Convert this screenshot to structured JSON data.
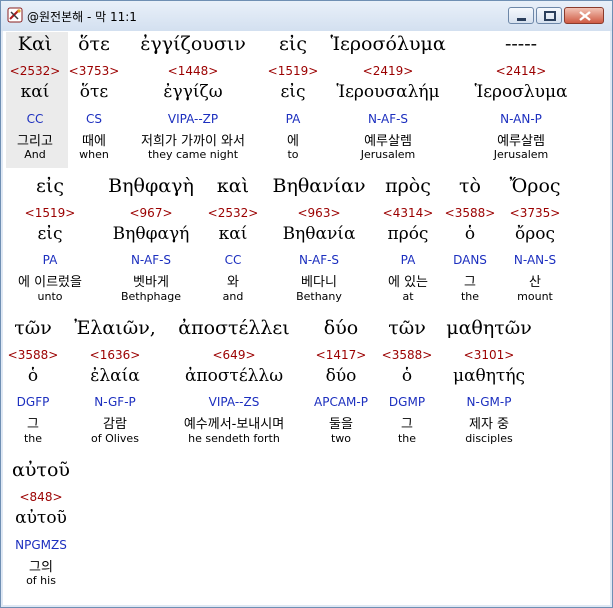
{
  "window": {
    "title": "@원전본해 - 막 11:1",
    "icon": "bible-app-icon"
  },
  "title_buttons": [
    "minimize-icon",
    "maximize-icon",
    "close-icon"
  ],
  "rows": [
    {
      "words": [
        {
          "greek": "Καὶ",
          "strong": "<2532>",
          "lexical": "καί",
          "parsing": "CC",
          "korean": "그리고",
          "english": "And",
          "selected": true
        },
        {
          "greek": "ὅτε",
          "strong": "<3753>",
          "lexical": "ὅτε",
          "parsing": "CS",
          "korean": "때에",
          "english": "when"
        },
        {
          "greek": "ἐγγίζουσιν",
          "strong": "<1448>",
          "lexical": "ἐγγίζω",
          "parsing": "VIPA--ZP",
          "korean": "저희가 가까이 와서",
          "english": "they came night"
        },
        {
          "greek": "εἰς",
          "strong": "<1519>",
          "lexical": "εἰς",
          "parsing": "PA",
          "korean": "에",
          "english": "to"
        },
        {
          "greek": "Ἱεροσόλυμα",
          "strong": "<2419>",
          "lexical": "Ἱερουσαλήμ",
          "parsing": "N-AF-S",
          "korean": "예루살렘",
          "english": "Jerusalem"
        },
        {
          "greek": "-----",
          "strong": "<2414>",
          "lexical": "Ἱεροσλυμα",
          "parsing": "N-AN-P",
          "korean": "예루살렘",
          "english": "Jerusalem"
        }
      ]
    },
    {
      "words": [
        {
          "greek": "εἰς",
          "strong": "<1519>",
          "lexical": "εἰς",
          "parsing": "PA",
          "korean": "에 이르렀을",
          "english": "unto"
        },
        {
          "greek": "Βηθφαγὴ",
          "strong": "<967>",
          "lexical": "Βηθφαγή",
          "parsing": "N-AF-S",
          "korean": "벳바게",
          "english": "Bethphage"
        },
        {
          "greek": "καὶ",
          "strong": "<2532>",
          "lexical": "καί",
          "parsing": "CC",
          "korean": "와",
          "english": "and"
        },
        {
          "greek": "Βηθανίαν",
          "strong": "<963>",
          "lexical": "Βηθανία",
          "parsing": "N-AF-S",
          "korean": "베다니",
          "english": "Bethany"
        },
        {
          "greek": "πρὸς",
          "strong": "<4314>",
          "lexical": "πρός",
          "parsing": "PA",
          "korean": "에 있는",
          "english": "at"
        },
        {
          "greek": "τὸ",
          "strong": "<3588>",
          "lexical": "ὁ",
          "parsing": "DANS",
          "korean": "그",
          "english": "the"
        },
        {
          "greek": "Ὄρος",
          "strong": "<3735>",
          "lexical": "ὄρος",
          "parsing": "N-AN-S",
          "korean": "산",
          "english": "mount"
        }
      ]
    },
    {
      "words": [
        {
          "greek": "τῶν",
          "strong": "<3588>",
          "lexical": "ὁ",
          "parsing": "DGFP",
          "korean": "그",
          "english": "the"
        },
        {
          "greek": "Ἐλαιῶν,",
          "strong": "<1636>",
          "lexical": "ἐλαία",
          "parsing": "N-GF-P",
          "korean": "감람",
          "english": "of Olives"
        },
        {
          "greek": "ἀποστέλλει",
          "strong": "<649>",
          "lexical": "ἀποστέλλω",
          "parsing": "VIPA--ZS",
          "korean": "예수께서-보내시며",
          "english": "he sendeth forth"
        },
        {
          "greek": "δύο",
          "strong": "<1417>",
          "lexical": "δύο",
          "parsing": "APCAM-P",
          "korean": "둘을",
          "english": "two"
        },
        {
          "greek": "τῶν",
          "strong": "<3588>",
          "lexical": "ὁ",
          "parsing": "DGMP",
          "korean": "그",
          "english": "the"
        },
        {
          "greek": "μαθητῶν",
          "strong": "<3101>",
          "lexical": "μαθητής",
          "parsing": "N-GM-P",
          "korean": "제자 중",
          "english": "disciples"
        }
      ]
    },
    {
      "words": [
        {
          "greek": "αὐτοῦ",
          "strong": "<848>",
          "lexical": "αὐτοῦ",
          "parsing": "NPGMZS",
          "korean": "그의",
          "english": "of his"
        }
      ]
    }
  ]
}
